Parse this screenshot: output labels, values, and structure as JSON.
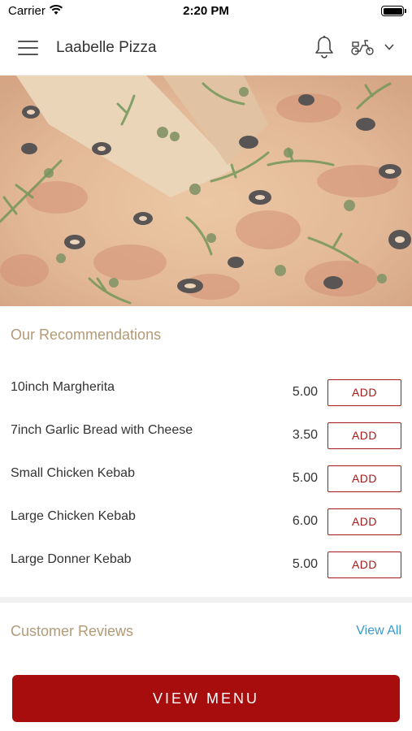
{
  "status_bar": {
    "carrier": "Carrier",
    "time": "2:20 PM"
  },
  "header": {
    "title": "Laabelle Pizza"
  },
  "icons": {
    "menu": "hamburger-menu-icon",
    "bell": "bell-icon",
    "delivery": "scooter-icon",
    "dropdown": "chevron-down-icon"
  },
  "recommendations": {
    "title": "Our Recommendations",
    "add_label": "ADD",
    "items": [
      {
        "name": "10inch Margherita",
        "price": "5.00"
      },
      {
        "name": "7inch Garlic Bread with Cheese",
        "price": "3.50"
      },
      {
        "name": "Small Chicken Kebab",
        "price": "5.00"
      },
      {
        "name": "Large Chicken Kebab",
        "price": "6.00"
      },
      {
        "name": "Large Donner Kebab",
        "price": "5.00"
      }
    ]
  },
  "reviews": {
    "title": "Customer Reviews",
    "view_all": "View All"
  },
  "footer": {
    "view_menu": "VIEW MENU"
  },
  "colors": {
    "accent": "#a80d0d",
    "section_title": "#b29a76",
    "link": "#3a9ac9"
  }
}
